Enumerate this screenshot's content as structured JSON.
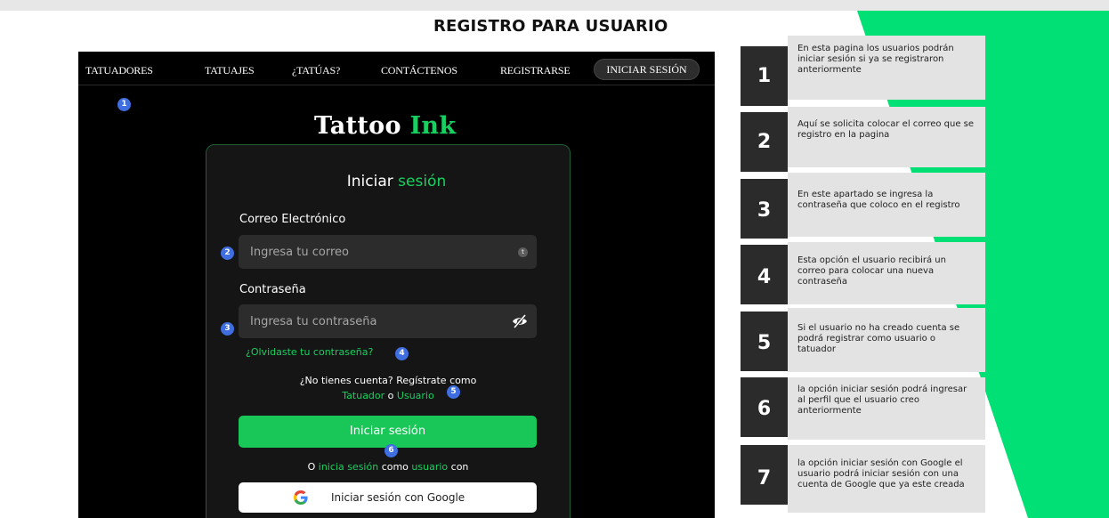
{
  "page": {
    "title": "REGISTRO PARA USUARIO"
  },
  "colors": {
    "accent_green": "#18d061",
    "background_green": "#00e075",
    "panel_dark": "#000000",
    "legend_number_bg": "#2b2b2b",
    "legend_desc_bg": "#e3e3e3",
    "marker_blue": "#3f6ee0"
  },
  "nav": {
    "items": [
      "TATUADORES",
      "TATUAJES",
      "¿TATÚAS?",
      "CONTÁCTENOS",
      "REGISTRARSE"
    ],
    "active_item": "INICIAR SESIÓN"
  },
  "brand": {
    "part1": "Tattoo",
    "part2": "Ink"
  },
  "login": {
    "title_part1": "Iniciar",
    "title_part2": "sesión",
    "email_label": "Correo Electrónico",
    "email_placeholder": "Ingresa tu correo",
    "email_badge": "t",
    "password_label": "Contraseña",
    "password_placeholder": "Ingresa tu contraseña",
    "forgot_password": "¿Olvidaste tu contraseña?",
    "no_account_text": "¿No tienes cuenta? Regístrate como",
    "tatuador_link": "Tatuador",
    "or_word": "o",
    "usuario_link": "Usuario",
    "submit_label": "Iniciar sesión",
    "alt_prefix": "O",
    "alt_link1": "inicia sesión",
    "alt_middle": "como",
    "alt_link2": "usuario",
    "alt_suffix": "con",
    "google_label": "Iniciar sesión con Google"
  },
  "markers": [
    "1",
    "2",
    "3",
    "4",
    "5",
    "6"
  ],
  "legend": [
    {
      "number": "1",
      "text": "En esta pagina los usuarios podrán iniciar sesión si ya se registraron anteriormente"
    },
    {
      "number": "2",
      "text": "Aquí se solicita colocar el correo que se registro en la pagina"
    },
    {
      "number": "3",
      "text": "En este apartado se ingresa la contraseña que coloco en el registro"
    },
    {
      "number": "4",
      "text": "Esta opción el usuario recibirá un correo para colocar una nueva contraseña"
    },
    {
      "number": "5",
      "text": "Si el usuario no ha creado cuenta se podrá registrar como usuario o tatuador"
    },
    {
      "number": "6",
      "text": "la opción  iniciar sesión podrá ingresar al perfil que el usuario creo anteriormente"
    },
    {
      "number": "7",
      "text": "la opción  iniciar sesión con Google el usuario podrá iniciar sesión con una cuenta de Google que ya este creada"
    }
  ]
}
